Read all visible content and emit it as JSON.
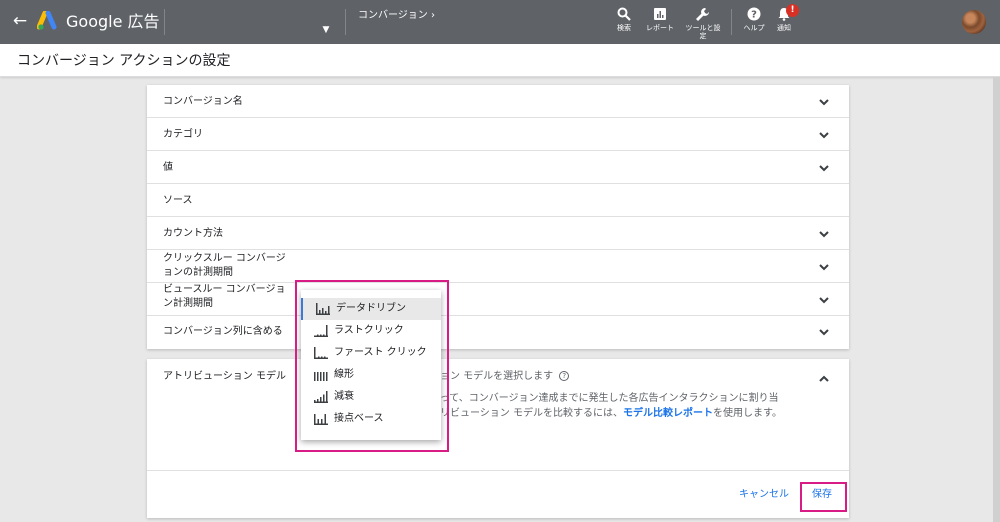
{
  "header": {
    "brand": "Google 広告",
    "breadcrumb": "コンバージョン ›",
    "buttons": [
      {
        "label": "検索",
        "icon": "search-icon"
      },
      {
        "label": "レポート",
        "icon": "report-icon"
      },
      {
        "label": "ツールと設定",
        "icon": "wrench-icon"
      },
      {
        "label": "ヘルプ",
        "icon": "help-icon"
      },
      {
        "label": "通知",
        "icon": "bell-icon",
        "badge": "!"
      }
    ]
  },
  "page": {
    "title": "コンバージョン アクションの設定"
  },
  "settings": {
    "rows": [
      {
        "label": "コンバージョン名"
      },
      {
        "label": "カテゴリ"
      },
      {
        "label": "値"
      },
      {
        "label": "ソース"
      },
      {
        "label": "カウント方法"
      },
      {
        "label_line1": "クリックスルー コンバージ",
        "label_line2": "ョンの計測期間"
      },
      {
        "label_line1": "ビュースルー コンバージョ",
        "label_line2": "ン計測期間"
      },
      {
        "label": "コンバージョン列に含める"
      }
    ]
  },
  "attribution": {
    "title": "アトリビューション モデル",
    "select_prompt": "ション モデルを選択します",
    "desc_line1": "よって、コンバージョン達成までに発生した各広告インタラクションに割り当",
    "desc_line2_pre": "トリビューション モデルを比較するには、",
    "desc_link": "モデル比較レポート",
    "desc_line2_post": "を使用します。",
    "cancel": "キャンセル",
    "save": "保存"
  },
  "dropdown": {
    "selected": "データドリブン",
    "options": [
      {
        "label": "データドリブン",
        "icon": "data-driven-icon"
      },
      {
        "label": "ラストクリック",
        "icon": "last-click-icon"
      },
      {
        "label": "ファースト クリック",
        "icon": "first-click-icon"
      },
      {
        "label": "線形",
        "icon": "linear-icon"
      },
      {
        "label": "減衰",
        "icon": "time-decay-icon"
      },
      {
        "label": "接点ベース",
        "icon": "position-based-icon"
      }
    ]
  },
  "colors": {
    "topbar": "#5f6368",
    "link": "#1a73e8",
    "highlight": "#d81b85",
    "badge": "#d93025"
  }
}
